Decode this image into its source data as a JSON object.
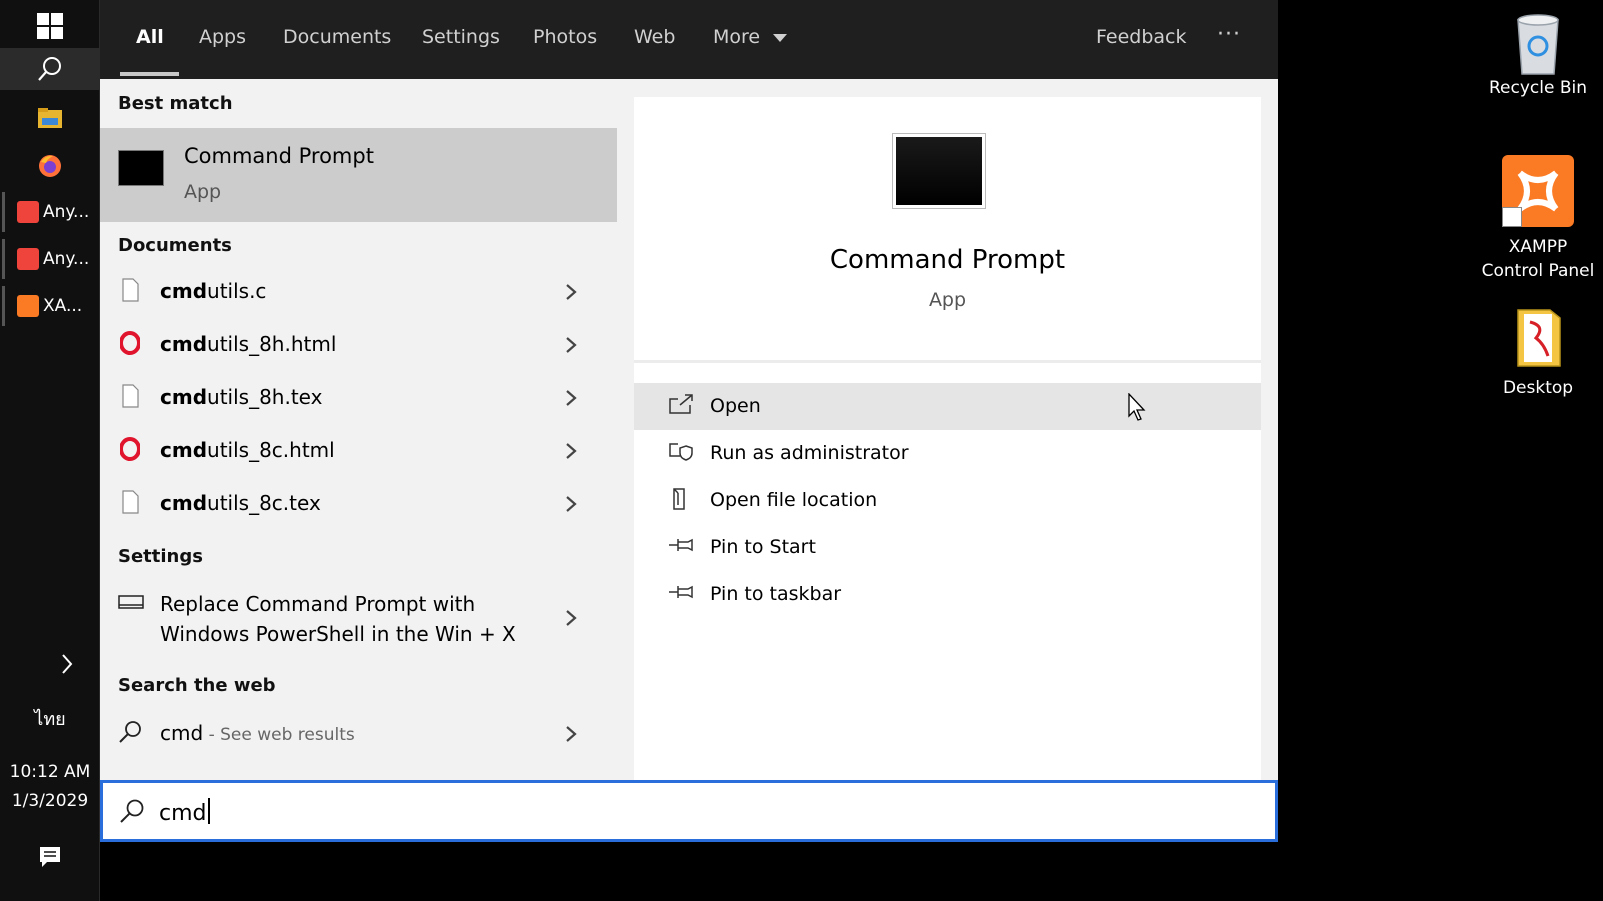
{
  "nav": {
    "tabs": [
      "All",
      "Apps",
      "Documents",
      "Settings",
      "Photos",
      "Web",
      "More"
    ],
    "feedback": "Feedback",
    "more_options": "···"
  },
  "best_match": {
    "heading": "Best match",
    "title": "Command Prompt",
    "subtitle": "App"
  },
  "documents": {
    "heading": "Documents",
    "bold_prefix": "cmd",
    "items": [
      {
        "suffix": "utils.c",
        "icon": "file-icon"
      },
      {
        "suffix": "utils_8h.html",
        "icon": "opera-icon"
      },
      {
        "suffix": "utils_8h.tex",
        "icon": "file-icon"
      },
      {
        "suffix": "utils_8c.html",
        "icon": "opera-icon"
      },
      {
        "suffix": "utils_8c.tex",
        "icon": "file-icon"
      }
    ]
  },
  "settings": {
    "heading": "Settings",
    "line1": "Replace Command Prompt with",
    "line2": "Windows PowerShell in the Win + X"
  },
  "web": {
    "heading": "Search the web",
    "query": "cmd",
    "hint": " - See web results"
  },
  "preview": {
    "title": "Command Prompt",
    "subtitle": "App",
    "actions": [
      "Open",
      "Run as administrator",
      "Open file location",
      "Pin to Start",
      "Pin to taskbar"
    ]
  },
  "search": {
    "value": "cmd"
  },
  "taskbar": {
    "apps": [
      "Any...",
      "Any...",
      "XA..."
    ],
    "language": "ไทย",
    "time": "10:12 AM",
    "date": "1/3/2029"
  },
  "desktop": {
    "recycle_bin": "Recycle Bin",
    "xampp_line1": "XAMPP",
    "xampp_line2": "Control Panel",
    "desktop": "Desktop"
  },
  "colors": {
    "nav_bg": "#1f1f1f",
    "selected_row": "#cccccc",
    "hover_row": "#e5e5e5",
    "search_border": "#2a6edc",
    "opera_red": "#e0142d",
    "anydesk_red": "#ef443b",
    "xampp_orange": "#fb7a24"
  }
}
